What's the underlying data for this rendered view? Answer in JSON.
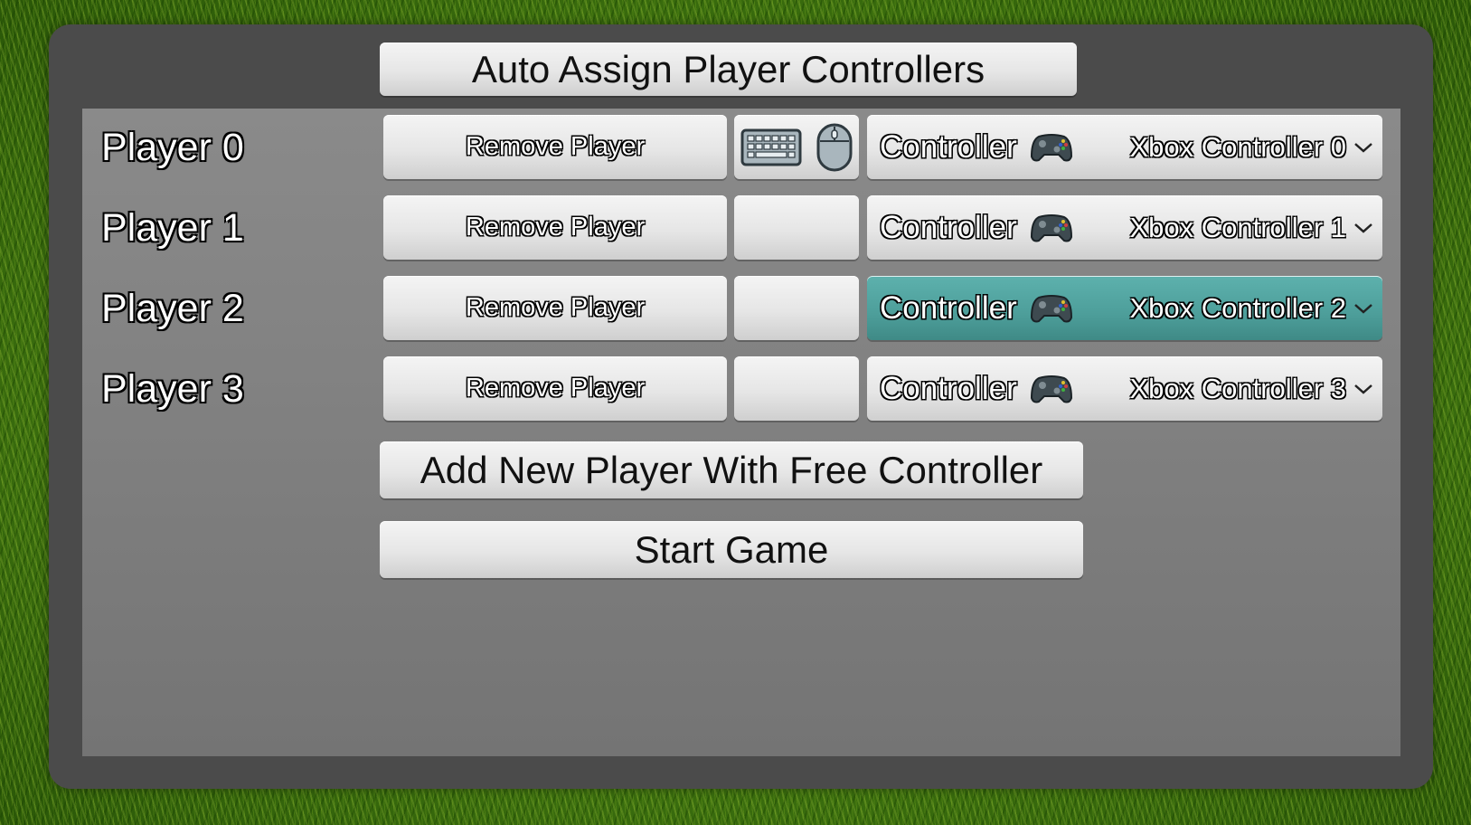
{
  "header": {
    "auto_assign_label": "Auto Assign Player Controllers"
  },
  "players": [
    {
      "label": "Player 0",
      "remove_label": "Remove Player",
      "input_icons": [
        "keyboard-icon",
        "mouse-icon"
      ],
      "controller_label": "Controller",
      "controller_value": "Xbox Controller 0",
      "selected": false
    },
    {
      "label": "Player 1",
      "remove_label": "Remove Player",
      "input_icons": [],
      "controller_label": "Controller",
      "controller_value": "Xbox Controller 1",
      "selected": false
    },
    {
      "label": "Player 2",
      "remove_label": "Remove Player",
      "input_icons": [],
      "controller_label": "Controller",
      "controller_value": "Xbox Controller 2",
      "selected": true
    },
    {
      "label": "Player 3",
      "remove_label": "Remove Player",
      "input_icons": [],
      "controller_label": "Controller",
      "controller_value": "Xbox Controller 3",
      "selected": false
    }
  ],
  "actions": {
    "add_player_label": "Add New Player With Free Controller",
    "start_game_label": "Start Game"
  },
  "colors": {
    "panel": "#4b4b4b",
    "inner": "#828282",
    "button": "#e6e6e6",
    "selected": "#4d9e9a"
  }
}
